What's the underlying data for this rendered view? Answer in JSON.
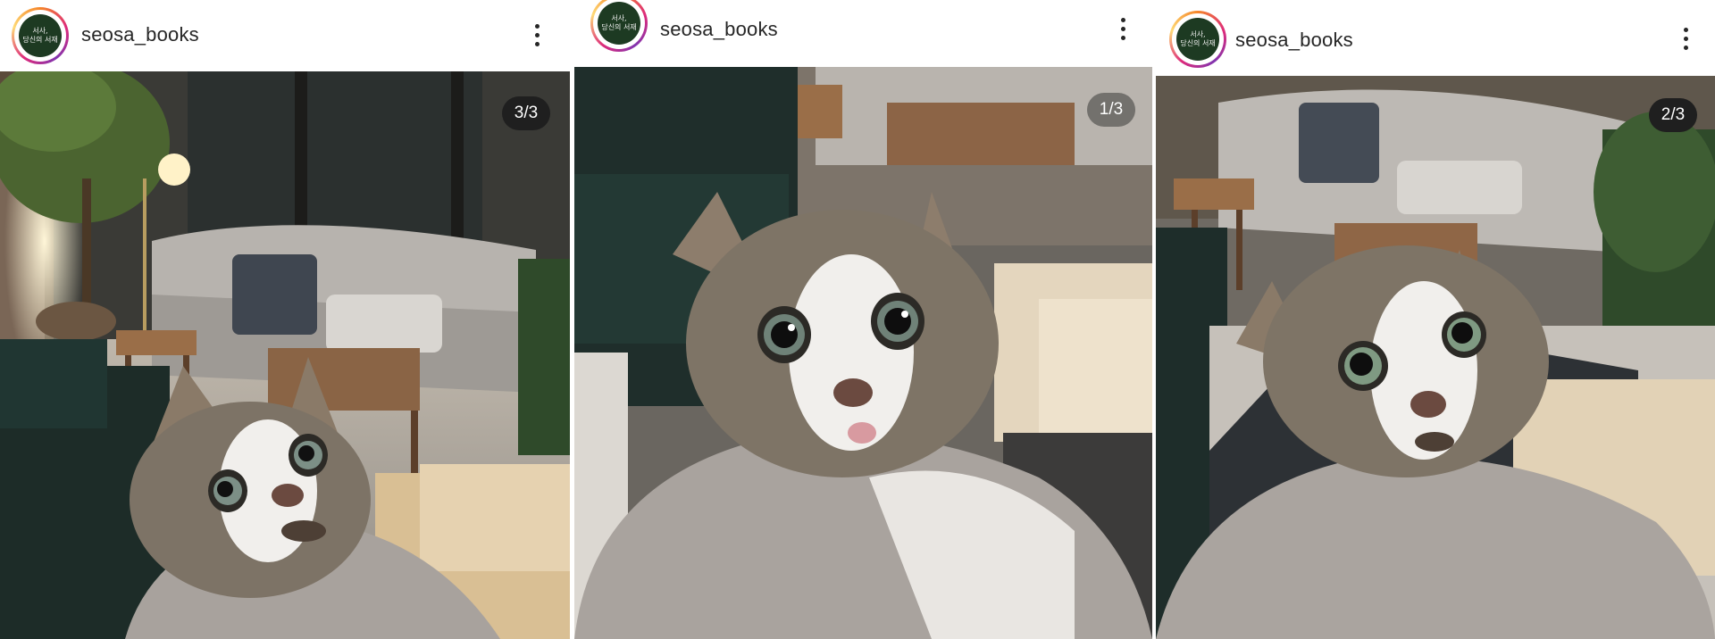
{
  "posts": [
    {
      "username": "seosa_books",
      "avatar_text": "서사,\n당신의 서재",
      "counter": "3/3"
    },
    {
      "username": "seosa_books",
      "avatar_text": "서사,\n당신의 서재",
      "counter": "1/3"
    },
    {
      "username": "seosa_books",
      "avatar_text": "서사,\n당신의 서재",
      "counter": "2/3"
    }
  ],
  "icons": {
    "more": "more-vertical-icon"
  },
  "colors": {
    "counter_bg": "#1f1f1f",
    "avatar_bg": "#1d3a22"
  }
}
